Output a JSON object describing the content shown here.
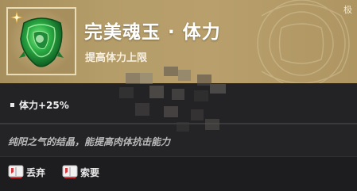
{
  "item": {
    "name": "完美魂玉 · 体力",
    "subtitle": "提高体力上限",
    "grade": "极",
    "icon": "green-jade-amulet"
  },
  "stats": [
    {
      "label": "体力+25%"
    }
  ],
  "description": "纯阳之气的结晶，能提高肉体抗击能力",
  "actions": [
    {
      "label": "丢弃",
      "icon": "key-book-icon"
    },
    {
      "label": "索要",
      "icon": "key-book-icon"
    }
  ],
  "colors": {
    "header_gold": "#b59d69",
    "panel_dark": "#1d1d20",
    "jade_green": "#2db24a",
    "key_red": "#d4383c"
  }
}
